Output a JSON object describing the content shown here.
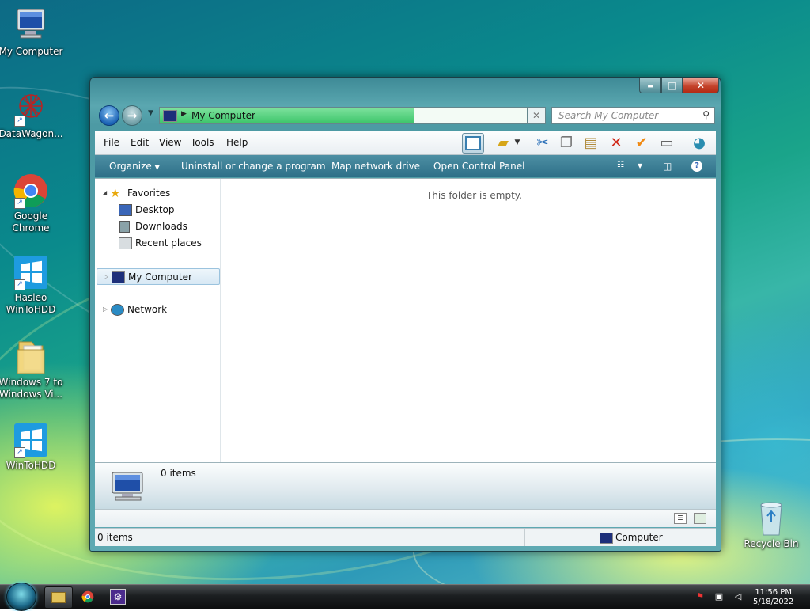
{
  "desktop": {
    "icons": [
      {
        "label": "My Computer",
        "icon": "computer-icon"
      },
      {
        "label": "DataWagon...",
        "icon": "datawagon-icon",
        "shortcut": true
      },
      {
        "label": "Google\nChrome",
        "icon": "chrome-icon",
        "shortcut": true
      },
      {
        "label": "Hasleo\nWinToHDD",
        "icon": "wintohdd-icon",
        "shortcut": true
      },
      {
        "label": "Windows 7 to\nWindows Vi...",
        "icon": "folder-icon"
      },
      {
        "label": "WinToHDD",
        "icon": "wintohdd-icon",
        "shortcut": true
      },
      {
        "label": "Recycle Bin",
        "icon": "recycle-bin-icon"
      }
    ]
  },
  "window": {
    "controls": {
      "minimize": "▬",
      "maximize": "□",
      "close": "✕"
    },
    "address": {
      "location": "My Computer",
      "progress_fraction": 0.66
    },
    "search": {
      "placeholder": "Search My Computer"
    },
    "menu": [
      "File",
      "Edit",
      "View",
      "Tools",
      "Help"
    ],
    "commands": {
      "organize": "Organize",
      "uninstall": "Uninstall or change a program",
      "map_drive": "Map network drive",
      "control_panel": "Open Control Panel"
    },
    "nav": {
      "favorites": "Favorites",
      "desktop": "Desktop",
      "downloads": "Downloads",
      "recent": "Recent places",
      "my_computer": "My Computer",
      "network": "Network"
    },
    "empty_message": "This folder is empty.",
    "details": {
      "count": "0 items"
    },
    "status": {
      "left": "0 items",
      "right": "Computer"
    }
  },
  "taskbar": {
    "clock": {
      "time": "11:56 PM",
      "date": "5/18/2022"
    }
  },
  "colors": {
    "accent": "#2d6f88",
    "address_progress": "#3cc56a",
    "close_button": "#c4432b"
  }
}
